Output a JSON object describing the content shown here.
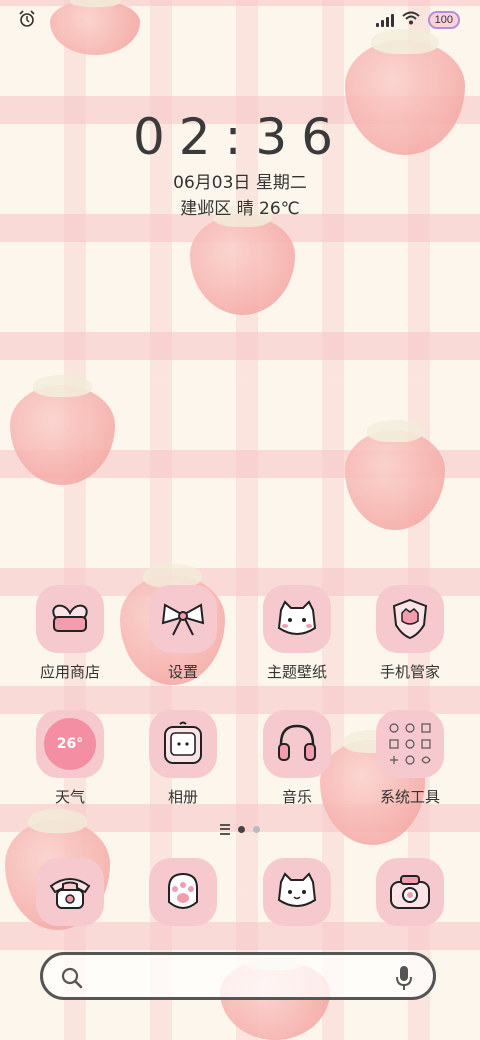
{
  "status_bar": {
    "alarm_icon": "alarm-clock-icon",
    "signal_icon": "signal-icon",
    "wifi_icon": "wifi-icon",
    "battery": "100"
  },
  "clock": {
    "time": "02:36",
    "date": "06月03日 星期二",
    "weather": "建邺区 晴 26℃"
  },
  "apps_row1": [
    {
      "label": "应用商店",
      "icon": "heart-box-icon"
    },
    {
      "label": "设置",
      "icon": "bow-icon"
    },
    {
      "label": "主题壁纸",
      "icon": "bear-face-icon"
    },
    {
      "label": "手机管家",
      "icon": "shield-icon"
    }
  ],
  "apps_row2": [
    {
      "label": "天气",
      "icon": "weather-badge-icon",
      "badge": "26°"
    },
    {
      "label": "相册",
      "icon": "photo-frame-icon"
    },
    {
      "label": "音乐",
      "icon": "music-note-icon"
    },
    {
      "label": "系统工具",
      "icon": "tools-folder-icon"
    }
  ],
  "dock": [
    {
      "icon": "phone-icon"
    },
    {
      "icon": "paw-icon"
    },
    {
      "icon": "messages-bear-icon"
    },
    {
      "icon": "camera-icon"
    }
  ],
  "colors": {
    "tile": "#f6c9cf",
    "background": "#fdf6ec",
    "text": "#333333"
  }
}
